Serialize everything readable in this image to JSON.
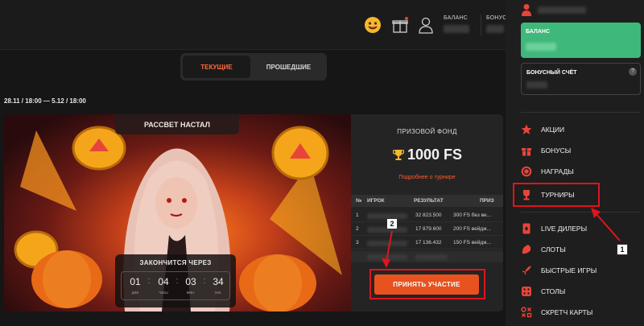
{
  "header": {
    "balance_label": "БАЛАНС",
    "bonus_label": "БОНУС"
  },
  "tabs": {
    "current": "ТЕКУЩИЕ",
    "past": "ПРОШЕДШИЕ"
  },
  "tournament": {
    "dates": "28.11 / 18:00 — 5.12 / 18:00",
    "title": "РАССВЕТ НАСТАЛ",
    "timer": {
      "label": "ЗАКОНЧИТСЯ ЧЕРЕЗ",
      "days": "01",
      "days_unit": "дни",
      "hours": "04",
      "hours_unit": "часы",
      "minutes": "03",
      "minutes_unit": "мин.",
      "seconds": "34",
      "seconds_unit": "сек."
    },
    "prize_label": "ПРИЗОВОЙ ФОНД",
    "prize_amount": "1000 FS",
    "more_link": "Подробнее о турнире",
    "table": {
      "headers": {
        "num": "№",
        "player": "ИГРОК",
        "result": "РЕЗУЛЬТАТ",
        "prize": "ПРИЗ"
      },
      "rows": [
        {
          "num": "1",
          "result": "32 823.500",
          "prize": "300 FS без ве..."
        },
        {
          "num": "2",
          "result": "17 879.600",
          "prize": "200 FS вейдж..."
        },
        {
          "num": "3",
          "result": "17 136.432",
          "prize": "150 FS вейдж..."
        }
      ]
    },
    "join_button": "ПРИНЯТЬ УЧАСТИЕ"
  },
  "annotations": {
    "step1": "1",
    "step2": "2"
  },
  "sidebar": {
    "balance_label": "БАЛАНС",
    "bonus_account_label": "БОНУСНЫЙ СЧЁТ",
    "help_icon": "?",
    "items": [
      {
        "label": "АКЦИИ",
        "icon": "star-icon"
      },
      {
        "label": "БОНУСЫ",
        "icon": "gift-icon"
      },
      {
        "label": "НАГРАДЫ",
        "icon": "medal-icon"
      },
      {
        "label": "ТУРНИРЫ",
        "icon": "trophy-icon"
      },
      {
        "label": "LIVE ДИЛЕРЫ",
        "icon": "cards-icon"
      },
      {
        "label": "СЛОТЫ",
        "icon": "slots-icon"
      },
      {
        "label": "БЫСТРЫЕ ИГРЫ",
        "icon": "rocket-icon"
      },
      {
        "label": "СТОЛЫ",
        "icon": "dice-icon"
      },
      {
        "label": "СКРЕТЧ КАРТЫ",
        "icon": "scratch-icon"
      }
    ]
  },
  "colors": {
    "accent": "#e8521e",
    "balance_card": "#3fb87b",
    "sidebar_icon": "#e8453a",
    "annotation": "#e0141c"
  }
}
